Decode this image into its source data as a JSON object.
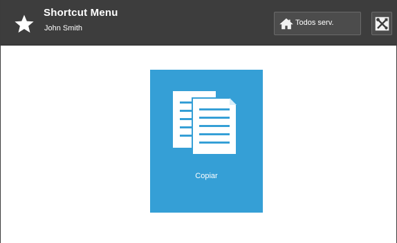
{
  "header": {
    "title": "Shortcut Menu",
    "user": "John Smith",
    "icon": "star-icon",
    "background_color": "#3d3d3d"
  },
  "toolbar": {
    "all_services_label": "Todos serv.",
    "all_services_icon": "home-icon",
    "tools_icon": "tools-icon"
  },
  "tiles": [
    {
      "label": "Copiar",
      "icon": "copy-documents-icon",
      "color": "#359fd6"
    }
  ]
}
